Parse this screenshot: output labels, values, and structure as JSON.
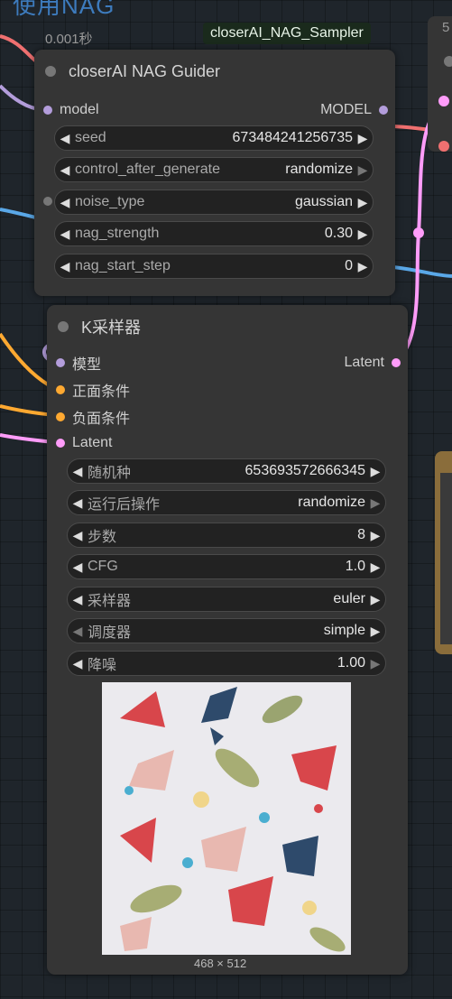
{
  "background_title": "使用NAG",
  "top_right_fragment": "5",
  "time_badge": "0.001秒",
  "pill_label": "closerAI_NAG_Sampler",
  "guider": {
    "title": "closerAI NAG Guider",
    "input_label": "model",
    "output_label": "MODEL",
    "widgets": [
      {
        "label": "seed",
        "value": "673484241256735",
        "right_dim": false
      },
      {
        "label": "control_after_generate",
        "value": "randomize",
        "right_dim": true
      },
      {
        "label": "noise_type",
        "value": "gaussian",
        "right_dim": false
      },
      {
        "label": "nag_strength",
        "value": "0.30",
        "right_dim": false
      },
      {
        "label": "nag_start_step",
        "value": "0",
        "right_dim": false
      }
    ]
  },
  "ksampler": {
    "title": "K采样器",
    "inputs": [
      {
        "label": "模型",
        "color": "#b39ddb"
      },
      {
        "label": "正面条件",
        "color": "#ffa931"
      },
      {
        "label": "负面条件",
        "color": "#ffa931"
      },
      {
        "label": "Latent",
        "color": "#ff9cf9"
      }
    ],
    "output_label": "Latent",
    "widgets": [
      {
        "label": "随机种",
        "value": "653693572666345",
        "right_dim": false
      },
      {
        "label": "运行后操作",
        "value": "randomize",
        "right_dim": true
      },
      {
        "label": "步数",
        "value": "8",
        "right_dim": false
      },
      {
        "label": "CFG",
        "value": "1.0",
        "right_dim": false
      },
      {
        "label": "采样器",
        "value": "euler",
        "right_dim": false
      },
      {
        "label": "调度器",
        "value": "simple",
        "right_dim": false
      },
      {
        "label": "降噪",
        "value": "1.00",
        "right_dim": true
      }
    ],
    "preview_caption": "468 × 512"
  },
  "colors": {
    "model_wire": "#b39ddb",
    "conditioning_wire": "#ffa931",
    "latent_wire": "#ff9cf9",
    "red_wire": "#f07070",
    "blue_wire": "#5aa8e8"
  }
}
